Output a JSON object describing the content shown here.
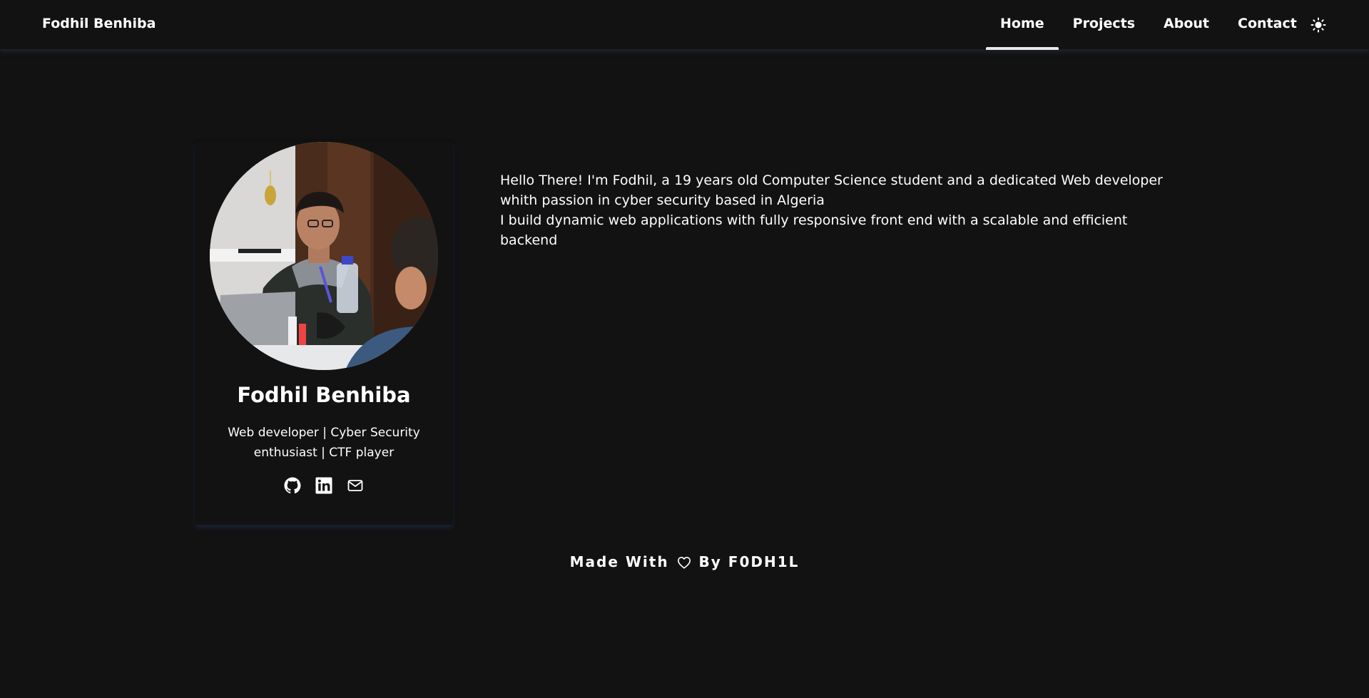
{
  "navbar": {
    "brand": "Fodhil Benhiba",
    "links": [
      {
        "label": "Home",
        "active": true
      },
      {
        "label": "Projects",
        "active": false
      },
      {
        "label": "About",
        "active": false
      },
      {
        "label": "Contact",
        "active": false
      }
    ],
    "theme_toggle_icon": "sun-icon"
  },
  "profile": {
    "name": "Fodhil Benhiba",
    "title": "Web developer | Cyber Security enthusiast | CTF player",
    "photo_alt": "Profile photo of Fodhil Benhiba",
    "socials": [
      {
        "name": "GitHub",
        "icon": "github-icon"
      },
      {
        "name": "LinkedIn",
        "icon": "linkedin-icon"
      },
      {
        "name": "Email",
        "icon": "mail-icon"
      }
    ]
  },
  "bio": {
    "line1": "Hello There! I'm Fodhil, a 19 years old Computer Science student and a dedicated Web developer whith passion in cyber security based in Algeria",
    "line2": "I build dynamic web applications with fully responsive front end with a scalable and efficient backend"
  },
  "footer": {
    "made_with": "Made With",
    "heart_icon": "heart-icon",
    "by": "By F0DH1L"
  },
  "colors": {
    "background": "#121212",
    "text": "#ffffff",
    "active_underline": "#e8e8e8"
  }
}
